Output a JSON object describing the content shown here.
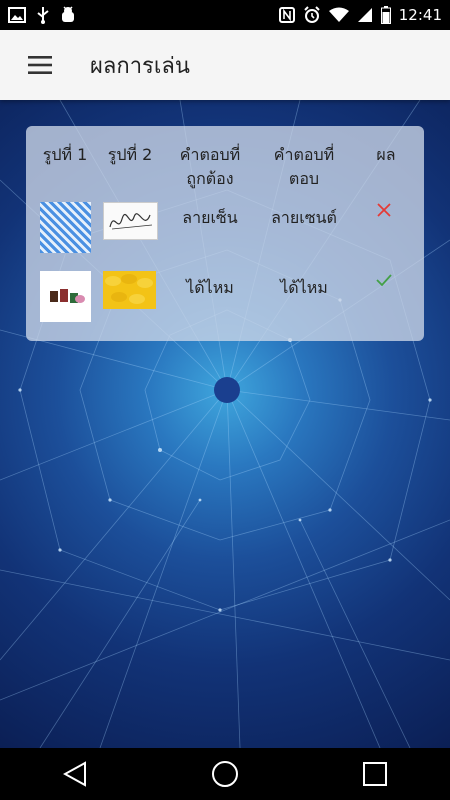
{
  "status_bar": {
    "time": "12:41"
  },
  "app_bar": {
    "title": "ผลการเล่น",
    "menu_icon": "hamburger-menu-icon"
  },
  "table": {
    "headers": {
      "picture1": "รูปที่ 1",
      "picture2": "รูปที่ 2",
      "correct_line1": "คำตอบที่",
      "correct_line2": "ถูกต้อง",
      "answered_line1": "คำตอบที่",
      "answered_line2": "ตอบ",
      "result": "ผล"
    },
    "rows": [
      {
        "correct_answer": "ลายเซ็น",
        "given_answer": "ลายเซนต์",
        "result_icon": "cross-icon",
        "result_color": "#e53935"
      },
      {
        "correct_answer": "ได้ไหม",
        "given_answer": "ได้ไหม",
        "result_icon": "check-icon",
        "result_color": "#43a047"
      }
    ]
  },
  "nav_bar": {
    "back": "back-icon",
    "home": "home-icon",
    "recents": "recents-icon"
  }
}
